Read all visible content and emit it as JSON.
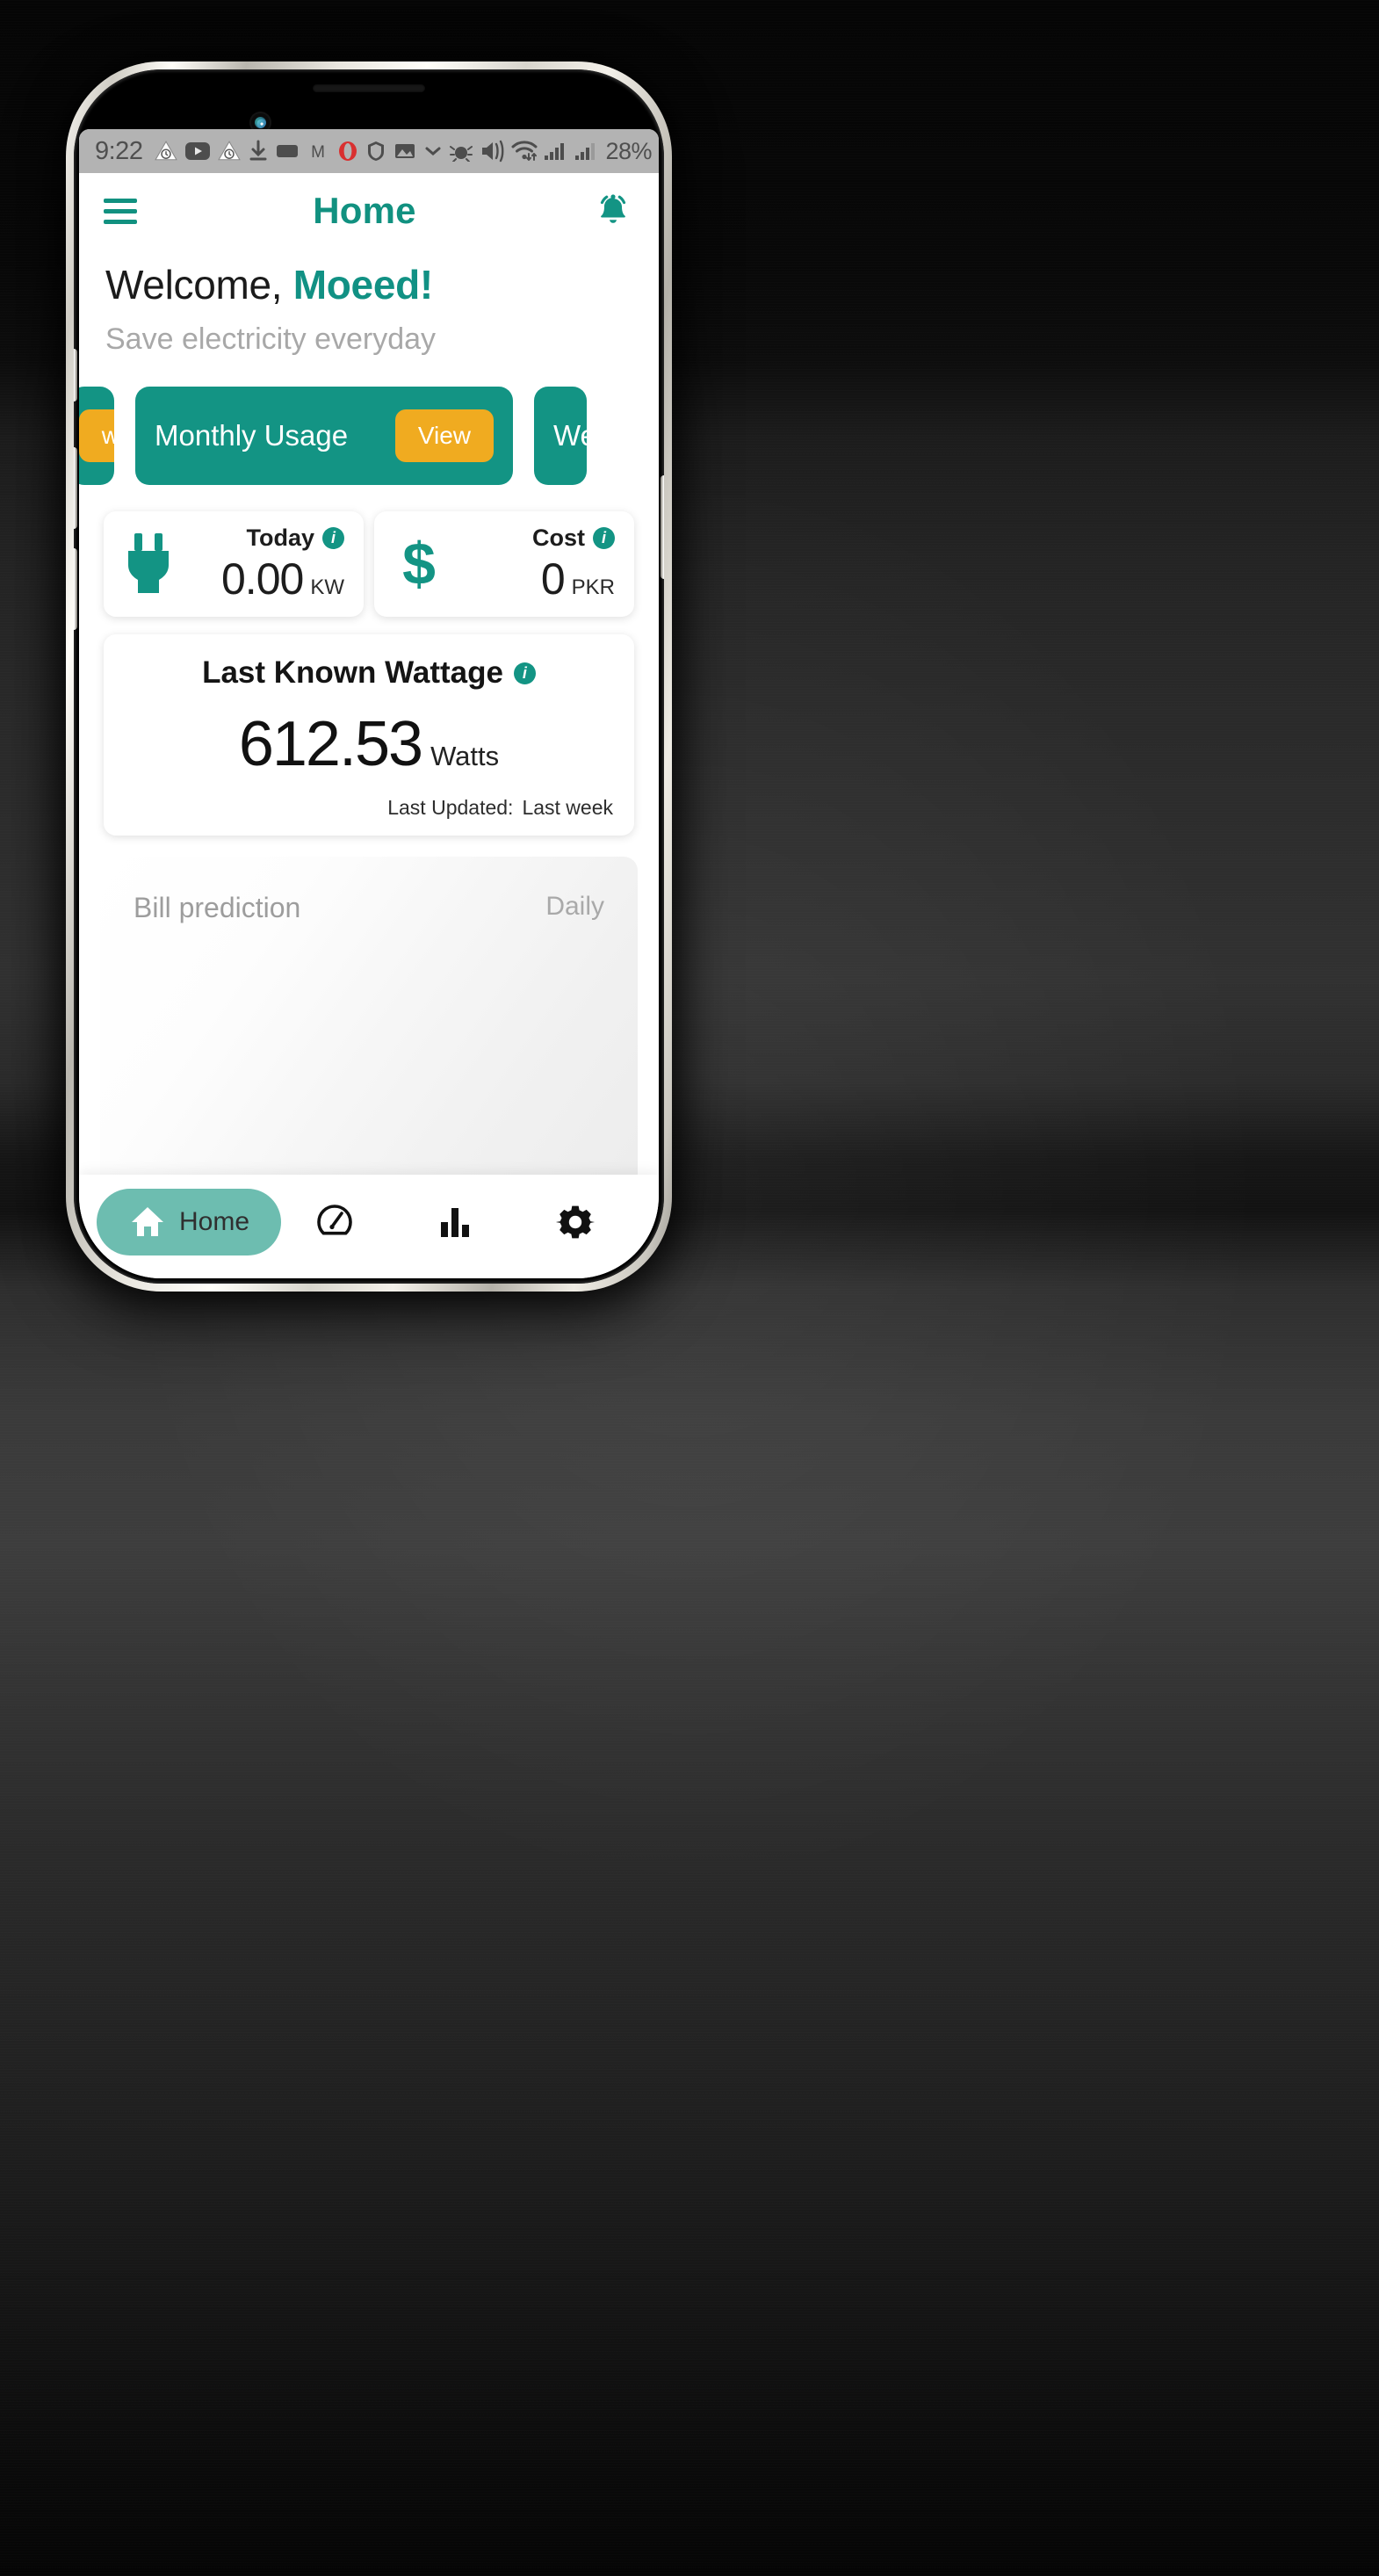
{
  "status_bar": {
    "time": "9:22",
    "battery_percent": "28%",
    "left_icons": [
      "alarm-warning-icon",
      "youtube-icon",
      "alarm-warning-icon",
      "download-icon",
      "sd-card-icon",
      "m-app-icon",
      "opera-icon",
      "shield-icon",
      "screenshot-icon",
      "chevron-down-icon"
    ],
    "right_icons": [
      "bug-icon",
      "vibrate-icon",
      "wifi-icon",
      "signal-sim1-icon",
      "signal-sim2-icon",
      "battery-charging-icon"
    ]
  },
  "app_bar": {
    "menu_icon": "hamburger-menu-icon",
    "title": "Home",
    "notification_icon": "bell-ringing-icon"
  },
  "welcome": {
    "greeting": "Welcome, ",
    "user_name": "Moeed!",
    "subtitle": "Save electricity everyday"
  },
  "carousel": {
    "previous_card": {
      "button_label_partial": "w"
    },
    "current_card": {
      "title": "Monthly Usage",
      "button_label": "View"
    },
    "next_card": {
      "title_partial": "We"
    }
  },
  "stats": [
    {
      "label": "Today",
      "icon": "power-plug-icon",
      "value": "0.00",
      "unit": "KW",
      "info_icon": "info-icon"
    },
    {
      "label": "Cost",
      "icon": "dollar-sign-icon",
      "value": "0",
      "unit": "PKR",
      "info_icon": "info-icon"
    }
  ],
  "wattage_card": {
    "title": "Last Known Wattage",
    "info_icon": "info-icon",
    "value": "612.53",
    "unit": "Watts",
    "updated_label": "Last Updated:",
    "updated_value": "Last week"
  },
  "bill_prediction": {
    "title": "Bill prediction",
    "range": "Daily"
  },
  "bottom_nav": [
    {
      "label": "Home",
      "icon": "home-icon",
      "active": true
    },
    {
      "label": "",
      "icon": "speedometer-icon",
      "active": false
    },
    {
      "label": "",
      "icon": "bar-chart-icon",
      "active": false
    },
    {
      "label": "",
      "icon": "gear-icon",
      "active": false
    }
  ],
  "colors": {
    "primary_teal": "#139484",
    "accent_amber": "#f0ab20",
    "nav_active": "#6dbdb0",
    "muted_text": "#a8a8a8"
  }
}
